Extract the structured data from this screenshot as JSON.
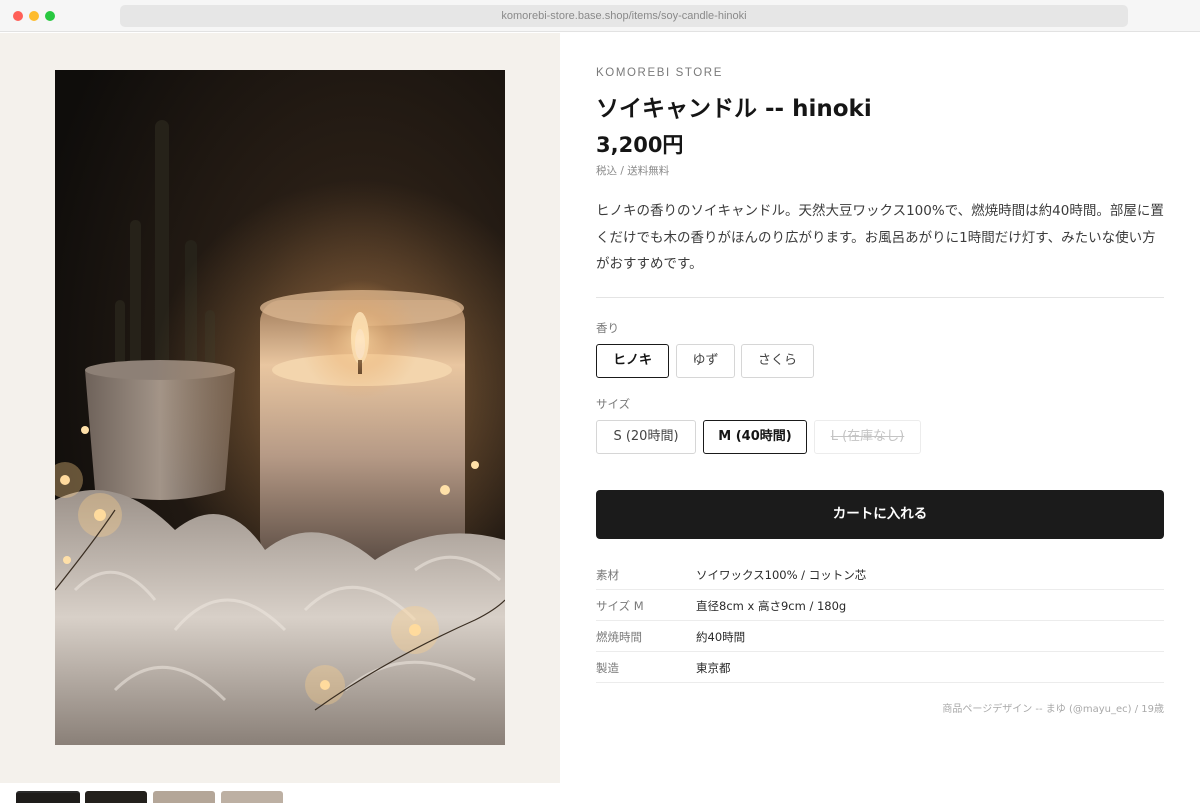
{
  "browser": {
    "url": "komorebi-store.base.shop/items/soy-candle-hinoki"
  },
  "gallery": {
    "main_image": "candle-photo",
    "thumbnails": [
      "candle-dark-1",
      "candle-dark-2",
      "candle-light-1",
      "candle-light-2"
    ]
  },
  "product": {
    "store": "KOMOREBI STORE",
    "title": "ソイキャンドル -- hinoki",
    "price": "3,200円",
    "tax_note": "税込 / 送料無料",
    "description": "ヒノキの香りのソイキャンドル。天然大豆ワックス100%で、燃焼時間は約40時間。部屋に置くだけでも木の香りがほんのり広がります。お風呂あがりに1時間だけ灯す、みたいな使い方がおすすめです。"
  },
  "options": {
    "scent_label": "香り",
    "scents": [
      {
        "label": "ヒノキ",
        "selected": true
      },
      {
        "label": "ゆず",
        "selected": false
      },
      {
        "label": "さくら",
        "selected": false
      }
    ],
    "size_label": "サイズ",
    "sizes": [
      {
        "label": "S (20時間)",
        "selected": false
      },
      {
        "label": "M (40時間)",
        "selected": true
      },
      {
        "label": "L (在庫なし)",
        "selected": false,
        "disabled": true
      }
    ]
  },
  "cart_button": "カートに入れる",
  "specs": [
    {
      "key": "素材",
      "value": "ソイワックス100% / コットン芯"
    },
    {
      "key": "サイズ M",
      "value": "直径8cm x 高さ9cm / 180g"
    },
    {
      "key": "燃焼時間",
      "value": "約40時間"
    },
    {
      "key": "製造",
      "value": "東京都"
    }
  ],
  "credit": "商品ページデザイン -- まゆ (@mayu_ec) / 19歳",
  "colors": {
    "accent": "#1b1b1b",
    "gallery_bg": "#f4f1ec"
  }
}
